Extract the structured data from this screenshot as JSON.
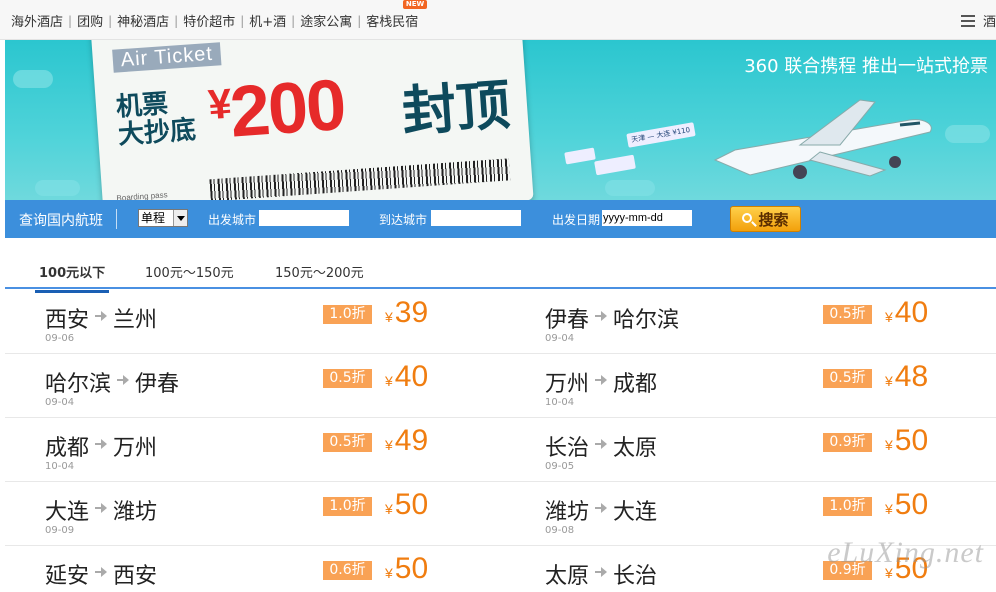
{
  "topnav": {
    "links": [
      "海外酒店",
      "团购",
      "神秘酒店",
      "特价超市",
      "机+酒",
      "途家公寓",
      "客栈民宿"
    ],
    "new_badge": "NEW",
    "right_label": "酒"
  },
  "banner": {
    "air_ticket": "Air Ticket",
    "line1": "机票",
    "line2": "大抄底",
    "yen": "¥",
    "amount": "200",
    "suffix": "封顶",
    "boarding": "Boarding pass",
    "mini_ticket": "天津 — 大连 ¥110",
    "slogan": "360 联合携程  推出一站式抢票"
  },
  "search": {
    "title": "查询国内航班",
    "trip_type": "单程",
    "from_label": "出发城市",
    "from_value": "",
    "to_label": "到达城市",
    "to_value": "",
    "date_label": "出发日期",
    "date_placeholder": "yyyy-mm-dd",
    "button": "搜索"
  },
  "tabs": [
    "100元以下",
    "100元～150元",
    "150元～200元"
  ],
  "fares": [
    [
      {
        "from": "西安",
        "to": "兰州",
        "date": "09-06",
        "discount": "1.0折",
        "price": "39"
      },
      {
        "from": "伊春",
        "to": "哈尔滨",
        "date": "09-04",
        "discount": "0.5折",
        "price": "40"
      }
    ],
    [
      {
        "from": "哈尔滨",
        "to": "伊春",
        "date": "09-04",
        "discount": "0.5折",
        "price": "40"
      },
      {
        "from": "万州",
        "to": "成都",
        "date": "10-04",
        "discount": "0.5折",
        "price": "48"
      }
    ],
    [
      {
        "from": "成都",
        "to": "万州",
        "date": "10-04",
        "discount": "0.5折",
        "price": "49"
      },
      {
        "from": "长治",
        "to": "太原",
        "date": "09-05",
        "discount": "0.9折",
        "price": "50"
      }
    ],
    [
      {
        "from": "大连",
        "to": "潍坊",
        "date": "09-09",
        "discount": "1.0折",
        "price": "50"
      },
      {
        "from": "潍坊",
        "to": "大连",
        "date": "09-08",
        "discount": "1.0折",
        "price": "50"
      }
    ],
    [
      {
        "from": "延安",
        "to": "西安",
        "date": "",
        "discount": "0.6折",
        "price": "50"
      },
      {
        "from": "太原",
        "to": "长治",
        "date": "",
        "discount": "0.9折",
        "price": "50"
      }
    ]
  ],
  "currency": "¥",
  "watermark": "eLuXing.net",
  "colors": {
    "accent": "#3c8fdc",
    "price": "#f07d10",
    "discount_bg": "#f9a255",
    "banner": "#2bc6cf"
  }
}
